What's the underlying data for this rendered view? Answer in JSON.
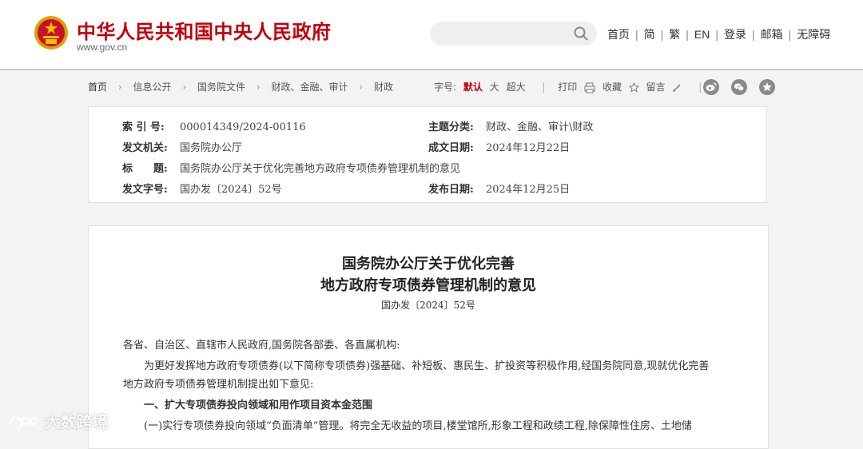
{
  "header": {
    "site_title": "中华人民共和国中央人民政府",
    "site_url": "www.gov.cn",
    "search_placeholder": "",
    "links": [
      "首页",
      "简",
      "繁",
      "EN",
      "登录",
      "邮箱",
      "无障碍"
    ]
  },
  "breadcrumb": [
    "首页",
    "信息公开",
    "国务院文件",
    "财政、金融、审计",
    "财政"
  ],
  "tools": {
    "font_label": "字号:",
    "font_default": "默认",
    "font_large": "大",
    "font_xlarge": "超大",
    "print": "打印",
    "favorite": "收藏",
    "comment": "留言"
  },
  "info": {
    "index_label": "索 引 号:",
    "index_value": "000014349/2024-00116",
    "category_label": "主题分类:",
    "category_value": "财政、金融、审计\\财政",
    "issuer_label": "发文机关:",
    "issuer_value": "国务院办公厅",
    "created_label": "成文日期:",
    "created_value": "2024年12月22日",
    "title_label": "标　　题:",
    "title_value": "国务院办公厅关于优化完善地方政府专项债券管理机制的意见",
    "docno_label": "发文字号:",
    "docno_value": "国办发〔2024〕52号",
    "published_label": "发布日期:",
    "published_value": "2024年12月25日"
  },
  "document": {
    "title_line1": "国务院办公厅关于优化完善",
    "title_line2": "地方政府专项债券管理机制的意见",
    "doc_no": "国办发〔2024〕52号",
    "salutation": "各省、自治区、直辖市人民政府,国务院各部委、各直属机构:",
    "para1_line1": "为更好发挥地方政府专项债券(以下简称专项债券)强基础、补短板、惠民生、扩投资等积极作用,经国务院同意,现就优化完善",
    "para1_line2": "地方政府专项债券管理机制提出如下意见:",
    "heading1": "一、扩大专项债券投向领域和用作项目资本金范围",
    "para2": "(一)实行专项债券投向领域“负面清单”管理。将完全无收益的项目,楼堂馆所,形象工程和政绩工程,除保障性住房、土地储"
  },
  "watermark": "大数跨境",
  "colors": {
    "brand_red": "#c0000b",
    "background": "#f3f3f3"
  }
}
